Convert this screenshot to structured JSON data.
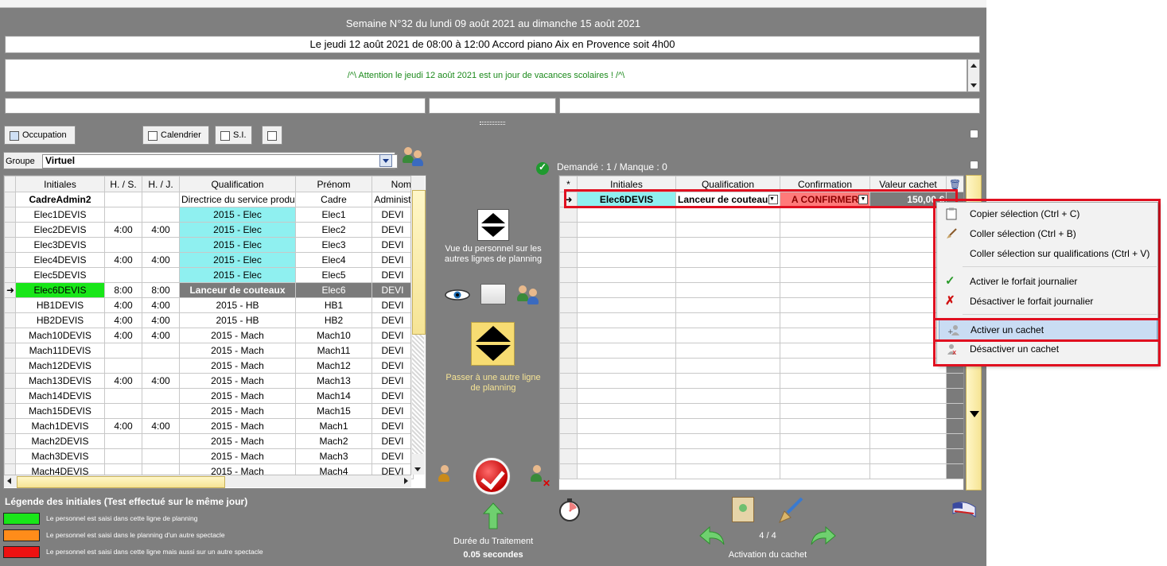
{
  "header": {
    "week_title": "Semaine N°32 du lundi 09 août 2021 au dimanche 15 août 2021",
    "event_line": "Le jeudi 12 août 2021  de  08:00  à  12:00  Accord piano  Aix en Provence soit 4h00",
    "warning": "/^\\ Attention le jeudi 12 août 2021 est un jour de vacances scolaires ! /^\\"
  },
  "toolbar": {
    "occupation": "Occupation",
    "calendrier": "Calendrier",
    "si": "S.I.",
    "group_label": "Groupe",
    "group_value": "Virtuel"
  },
  "left_grid": {
    "columns": [
      "Initiales",
      "H. / S.",
      "H. / J.",
      "Qualification",
      "Prénom",
      "Nom"
    ],
    "rows": [
      {
        "initiales": "CadreAdmin2",
        "hs": "",
        "hj": "",
        "qualif": "Directrice du service produ",
        "prenom": "Cadre",
        "nom": "Administ"
      },
      {
        "initiales": "Elec1DEVIS",
        "hs": "",
        "hj": "",
        "qualif": "2015 - Elec",
        "prenom": "Elec1",
        "nom": "DEVI"
      },
      {
        "initiales": "Elec2DEVIS",
        "hs": "4:00",
        "hj": "4:00",
        "qualif": "2015 - Elec",
        "prenom": "Elec2",
        "nom": "DEVI"
      },
      {
        "initiales": "Elec3DEVIS",
        "hs": "",
        "hj": "",
        "qualif": "2015 - Elec",
        "prenom": "Elec3",
        "nom": "DEVI"
      },
      {
        "initiales": "Elec4DEVIS",
        "hs": "4:00",
        "hj": "4:00",
        "qualif": "2015 - Elec",
        "prenom": "Elec4",
        "nom": "DEVI"
      },
      {
        "initiales": "Elec5DEVIS",
        "hs": "",
        "hj": "",
        "qualif": "2015 - Elec",
        "prenom": "Elec5",
        "nom": "DEVI"
      },
      {
        "initiales": "Elec6DEVIS",
        "hs": "8:00",
        "hj": "8:00",
        "qualif": "Lanceur de couteaux",
        "prenom": "Elec6",
        "nom": "DEVI"
      },
      {
        "initiales": "HB1DEVIS",
        "hs": "4:00",
        "hj": "4:00",
        "qualif": "2015 - HB",
        "prenom": "HB1",
        "nom": "DEVI"
      },
      {
        "initiales": "HB2DEVIS",
        "hs": "4:00",
        "hj": "4:00",
        "qualif": "2015 - HB",
        "prenom": "HB2",
        "nom": "DEVI"
      },
      {
        "initiales": "Mach10DEVIS",
        "hs": "4:00",
        "hj": "4:00",
        "qualif": "2015 - Mach",
        "prenom": "Mach10",
        "nom": "DEVI"
      },
      {
        "initiales": "Mach11DEVIS",
        "hs": "",
        "hj": "",
        "qualif": "2015 - Mach",
        "prenom": "Mach11",
        "nom": "DEVI"
      },
      {
        "initiales": "Mach12DEVIS",
        "hs": "",
        "hj": "",
        "qualif": "2015 - Mach",
        "prenom": "Mach12",
        "nom": "DEVI"
      },
      {
        "initiales": "Mach13DEVIS",
        "hs": "4:00",
        "hj": "4:00",
        "qualif": "2015 - Mach",
        "prenom": "Mach13",
        "nom": "DEVI"
      },
      {
        "initiales": "Mach14DEVIS",
        "hs": "",
        "hj": "",
        "qualif": "2015 - Mach",
        "prenom": "Mach14",
        "nom": "DEVI"
      },
      {
        "initiales": "Mach15DEVIS",
        "hs": "",
        "hj": "",
        "qualif": "2015 - Mach",
        "prenom": "Mach15",
        "nom": "DEVI"
      },
      {
        "initiales": "Mach1DEVIS",
        "hs": "4:00",
        "hj": "4:00",
        "qualif": "2015 - Mach",
        "prenom": "Mach1",
        "nom": "DEVI"
      },
      {
        "initiales": "Mach2DEVIS",
        "hs": "",
        "hj": "",
        "qualif": "2015 - Mach",
        "prenom": "Mach2",
        "nom": "DEVI"
      },
      {
        "initiales": "Mach3DEVIS",
        "hs": "",
        "hj": "",
        "qualif": "2015 - Mach",
        "prenom": "Mach3",
        "nom": "DEVI"
      },
      {
        "initiales": "Mach4DEVIS",
        "hs": "",
        "hj": "",
        "qualif": "2015 - Mach",
        "prenom": "Mach4",
        "nom": "DEVI"
      }
    ]
  },
  "middle": {
    "view_staff_text": "Vue du personnel sur les autres lignes de planning",
    "switch_line_text": "Passer à une autre ligne de planning",
    "duration_label": "Durée du Traitement",
    "duration_value": "0.05 secondes"
  },
  "right_grid": {
    "demand_text": "Demandé : 1 / Manque : 0",
    "columns": [
      "*",
      "Initiales",
      "Qualification",
      "Confirmation",
      "Valeur cachet"
    ],
    "row": {
      "initiales": "Elec6DEVIS",
      "qualif": "Lanceur de couteau",
      "confirmation": "A CONFIRMER",
      "valeur": "150,00 €"
    }
  },
  "context_menu": {
    "items": [
      "Copier sélection (Ctrl + C)",
      "Coller sélection (Ctrl + B)",
      "Coller sélection sur qualifications (Ctrl + V)",
      "Activer le forfait journalier",
      "Désactiver le forfait journalier",
      "Activer un cachet",
      "Désactiver un cachet"
    ]
  },
  "legend": {
    "title": "Légende des initiales (Test effectué sur le même jour)",
    "items": [
      {
        "color": "#19e619",
        "text": "Le personnel est saisi dans cette ligne de planning"
      },
      {
        "color": "#ff8c1a",
        "text": "Le personnel est saisi  dans le planning d'un autre spectacle"
      },
      {
        "color": "#ee1111",
        "text": "Le personnel est saisi dans cette ligne mais aussi sur un autre spectacle"
      }
    ]
  },
  "footer": {
    "pager": "4 / 4",
    "action_label": "Activation du cachet"
  }
}
